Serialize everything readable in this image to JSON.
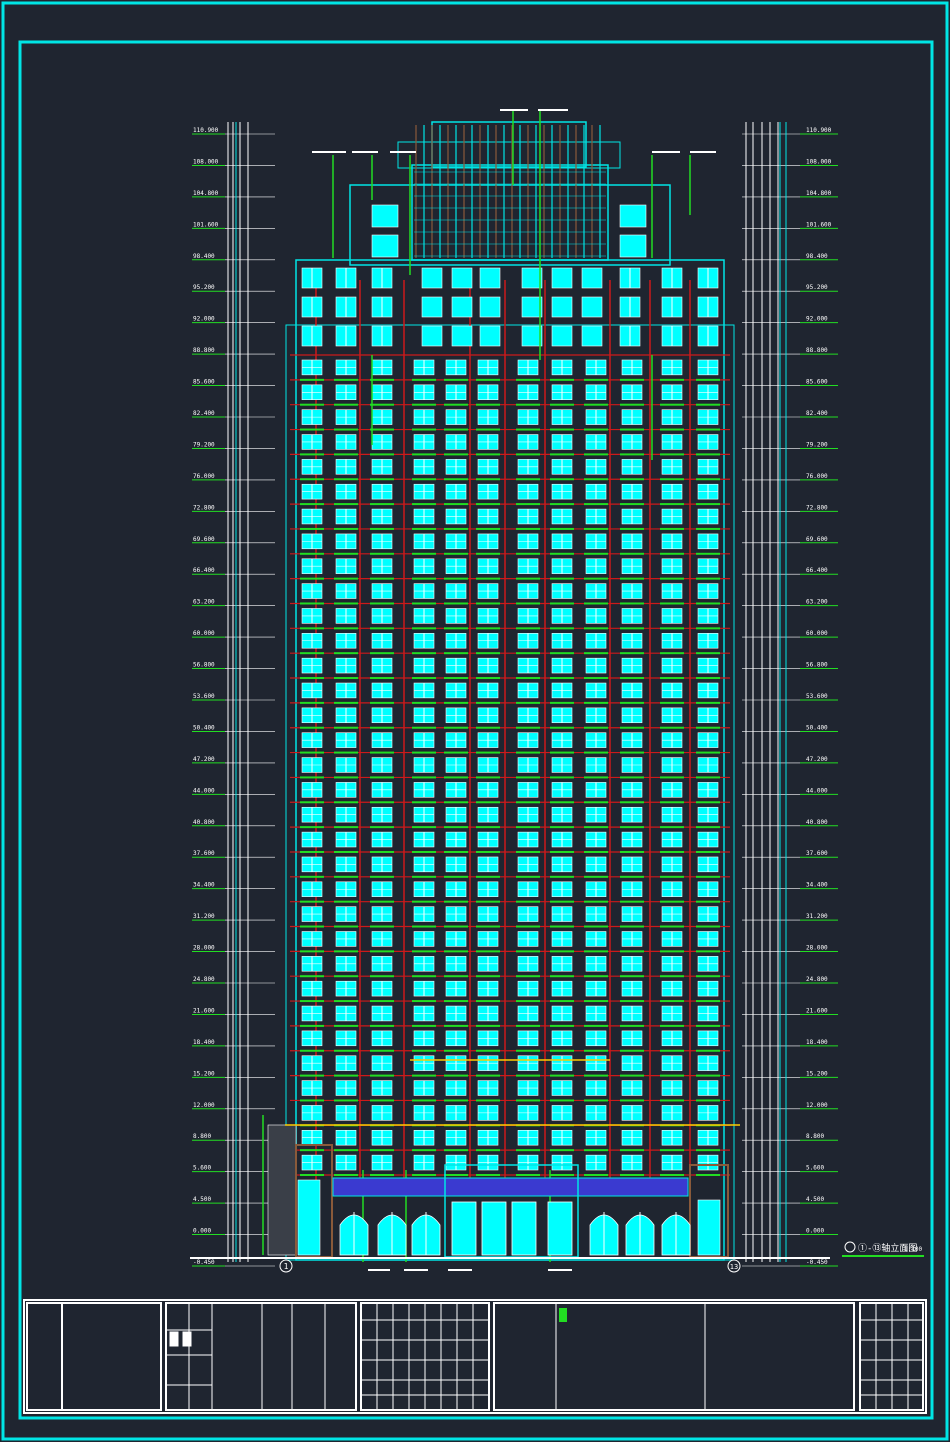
{
  "drawing": {
    "colors": {
      "background": "#1f2530",
      "frame": "#00e5e5",
      "window": "#00ffff",
      "facade_red": "#cc1a1a",
      "leader_green": "#22dd22",
      "white": "#ffffff",
      "brown": "#8a5a3a",
      "blue": "#3a3ad0",
      "yellow": "#ffcc00"
    },
    "title_label": "①-⑬轴立面图",
    "title_scale": "1:100",
    "axis_left": "1",
    "axis_right": "13",
    "floor_count": 33,
    "elevation_labels": [
      "110.900",
      "108.000",
      "104.800",
      "101.600",
      "98.400",
      "95.200",
      "92.000",
      "88.800",
      "85.600",
      "82.400",
      "79.200",
      "76.000",
      "72.800",
      "69.600",
      "66.400",
      "63.200",
      "60.000",
      "56.800",
      "53.600",
      "50.400",
      "47.200",
      "44.000",
      "40.800",
      "37.600",
      "34.400",
      "31.200",
      "28.000",
      "24.800",
      "21.600",
      "18.400",
      "15.200",
      "12.000",
      "8.800",
      "5.600",
      "4.500",
      "0.000",
      "-0.450"
    ],
    "icons": [
      "axis-bubble-icon",
      "section-marker-icon"
    ]
  }
}
